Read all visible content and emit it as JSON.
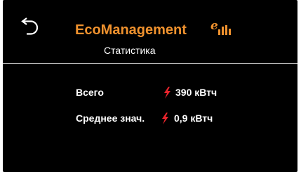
{
  "header": {
    "back_icon": "back-arrow-icon",
    "app_title": "EcoManagement",
    "app_logo_icon": "energy-meter-icon",
    "app_logo_letter": "e",
    "subtitle": "Статистика"
  },
  "stats": {
    "total": {
      "label": "Всего",
      "icon": "lightning-bolt-icon",
      "value": "390 кВтч"
    },
    "average": {
      "label": "Среднее знач.",
      "icon": "lightning-bolt-icon",
      "value": "0,9 кВтч"
    }
  },
  "colors": {
    "background": "#000000",
    "accent": "#f0922e",
    "bolt": "#e8242c",
    "text": "#ffffff",
    "divider": "#e8e8e8"
  }
}
